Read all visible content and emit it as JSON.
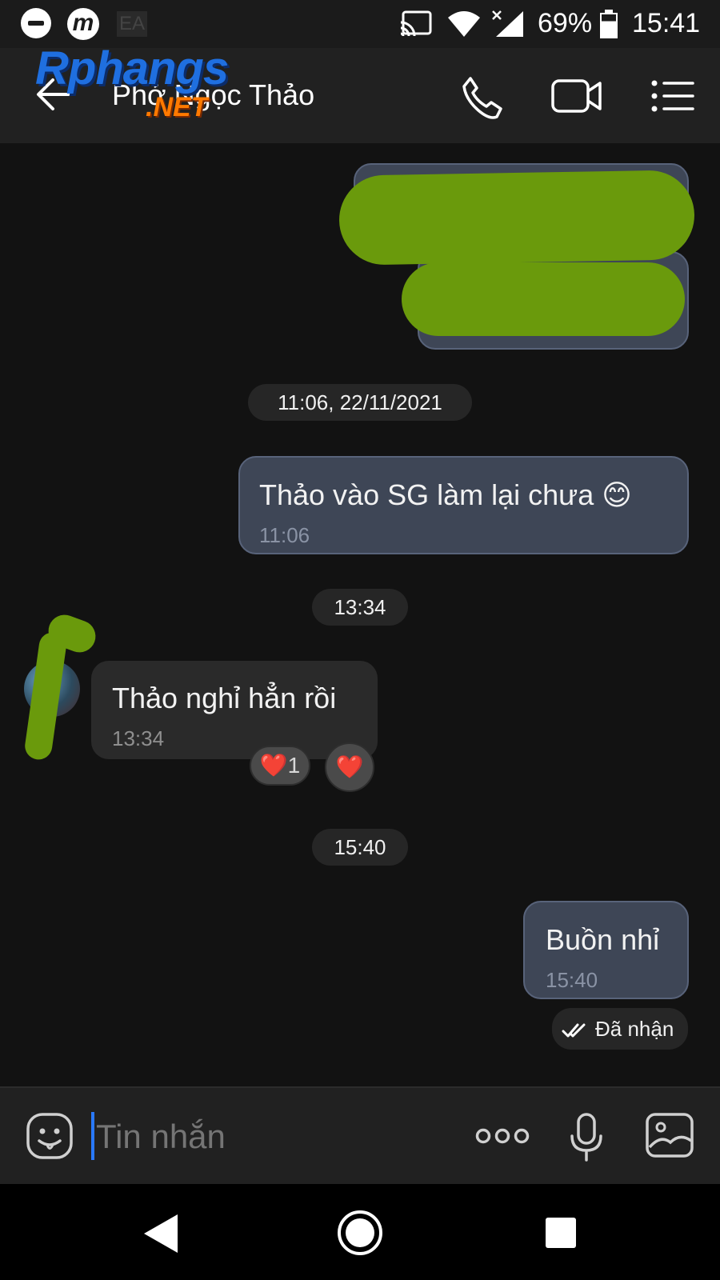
{
  "status_bar": {
    "battery": "69%",
    "time": "15:41",
    "notification_letters": "EA"
  },
  "header": {
    "contact_name": "Phở Ngọc Thảo"
  },
  "watermark": {
    "brand": "Rphangs",
    "suffix": ".NET"
  },
  "date_separators": {
    "first": "11:06, 22/11/2021",
    "second": "13:34",
    "third": "15:40"
  },
  "messages": [
    {
      "id": "m1",
      "direction": "outgoing",
      "text": "Thảo vào SG làm lại chưa 😊",
      "time": "11:06"
    },
    {
      "id": "m2",
      "direction": "incoming",
      "text": "Thảo nghỉ hẳn rồi",
      "time": "13:34"
    },
    {
      "id": "m3",
      "direction": "outgoing",
      "text": "Buồn nhỉ",
      "time": "15:40"
    }
  ],
  "reactions": {
    "count_reaction": {
      "emoji": "❤️",
      "count": "1"
    },
    "add_reaction": {
      "emoji": "❤️"
    }
  },
  "delivery_status": "Đã nhận",
  "composer": {
    "placeholder": "Tin nhắn"
  },
  "colors": {
    "outgoing_bubble": "#3e4656",
    "incoming_bubble": "#2a2a2a",
    "redaction_scribble": "#6a9a0c",
    "caret": "#2979ff"
  }
}
